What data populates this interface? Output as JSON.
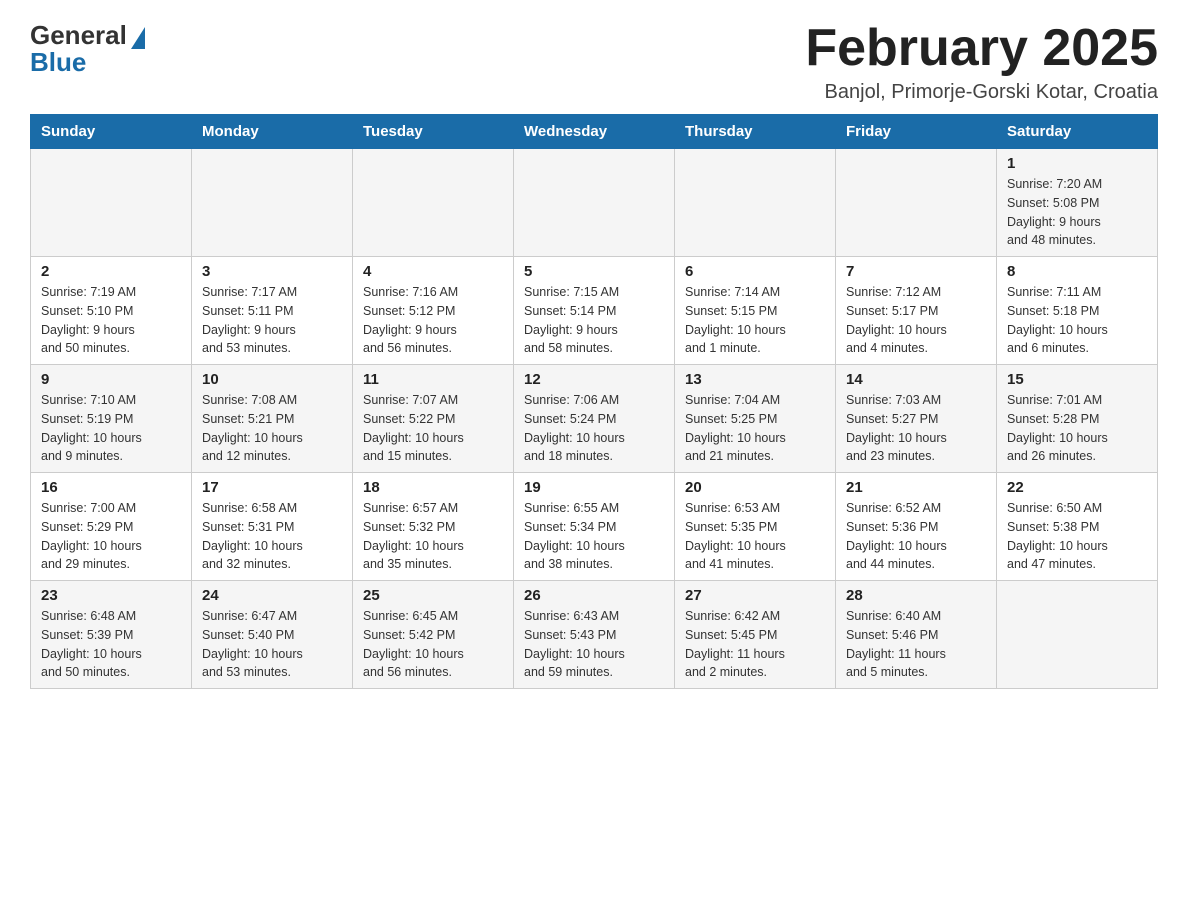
{
  "header": {
    "logo_general": "General",
    "logo_blue": "Blue",
    "title": "February 2025",
    "location": "Banjol, Primorje-Gorski Kotar, Croatia"
  },
  "weekdays": [
    "Sunday",
    "Monday",
    "Tuesday",
    "Wednesday",
    "Thursday",
    "Friday",
    "Saturday"
  ],
  "weeks": [
    [
      {
        "day": "",
        "info": ""
      },
      {
        "day": "",
        "info": ""
      },
      {
        "day": "",
        "info": ""
      },
      {
        "day": "",
        "info": ""
      },
      {
        "day": "",
        "info": ""
      },
      {
        "day": "",
        "info": ""
      },
      {
        "day": "1",
        "info": "Sunrise: 7:20 AM\nSunset: 5:08 PM\nDaylight: 9 hours\nand 48 minutes."
      }
    ],
    [
      {
        "day": "2",
        "info": "Sunrise: 7:19 AM\nSunset: 5:10 PM\nDaylight: 9 hours\nand 50 minutes."
      },
      {
        "day": "3",
        "info": "Sunrise: 7:17 AM\nSunset: 5:11 PM\nDaylight: 9 hours\nand 53 minutes."
      },
      {
        "day": "4",
        "info": "Sunrise: 7:16 AM\nSunset: 5:12 PM\nDaylight: 9 hours\nand 56 minutes."
      },
      {
        "day": "5",
        "info": "Sunrise: 7:15 AM\nSunset: 5:14 PM\nDaylight: 9 hours\nand 58 minutes."
      },
      {
        "day": "6",
        "info": "Sunrise: 7:14 AM\nSunset: 5:15 PM\nDaylight: 10 hours\nand 1 minute."
      },
      {
        "day": "7",
        "info": "Sunrise: 7:12 AM\nSunset: 5:17 PM\nDaylight: 10 hours\nand 4 minutes."
      },
      {
        "day": "8",
        "info": "Sunrise: 7:11 AM\nSunset: 5:18 PM\nDaylight: 10 hours\nand 6 minutes."
      }
    ],
    [
      {
        "day": "9",
        "info": "Sunrise: 7:10 AM\nSunset: 5:19 PM\nDaylight: 10 hours\nand 9 minutes."
      },
      {
        "day": "10",
        "info": "Sunrise: 7:08 AM\nSunset: 5:21 PM\nDaylight: 10 hours\nand 12 minutes."
      },
      {
        "day": "11",
        "info": "Sunrise: 7:07 AM\nSunset: 5:22 PM\nDaylight: 10 hours\nand 15 minutes."
      },
      {
        "day": "12",
        "info": "Sunrise: 7:06 AM\nSunset: 5:24 PM\nDaylight: 10 hours\nand 18 minutes."
      },
      {
        "day": "13",
        "info": "Sunrise: 7:04 AM\nSunset: 5:25 PM\nDaylight: 10 hours\nand 21 minutes."
      },
      {
        "day": "14",
        "info": "Sunrise: 7:03 AM\nSunset: 5:27 PM\nDaylight: 10 hours\nand 23 minutes."
      },
      {
        "day": "15",
        "info": "Sunrise: 7:01 AM\nSunset: 5:28 PM\nDaylight: 10 hours\nand 26 minutes."
      }
    ],
    [
      {
        "day": "16",
        "info": "Sunrise: 7:00 AM\nSunset: 5:29 PM\nDaylight: 10 hours\nand 29 minutes."
      },
      {
        "day": "17",
        "info": "Sunrise: 6:58 AM\nSunset: 5:31 PM\nDaylight: 10 hours\nand 32 minutes."
      },
      {
        "day": "18",
        "info": "Sunrise: 6:57 AM\nSunset: 5:32 PM\nDaylight: 10 hours\nand 35 minutes."
      },
      {
        "day": "19",
        "info": "Sunrise: 6:55 AM\nSunset: 5:34 PM\nDaylight: 10 hours\nand 38 minutes."
      },
      {
        "day": "20",
        "info": "Sunrise: 6:53 AM\nSunset: 5:35 PM\nDaylight: 10 hours\nand 41 minutes."
      },
      {
        "day": "21",
        "info": "Sunrise: 6:52 AM\nSunset: 5:36 PM\nDaylight: 10 hours\nand 44 minutes."
      },
      {
        "day": "22",
        "info": "Sunrise: 6:50 AM\nSunset: 5:38 PM\nDaylight: 10 hours\nand 47 minutes."
      }
    ],
    [
      {
        "day": "23",
        "info": "Sunrise: 6:48 AM\nSunset: 5:39 PM\nDaylight: 10 hours\nand 50 minutes."
      },
      {
        "day": "24",
        "info": "Sunrise: 6:47 AM\nSunset: 5:40 PM\nDaylight: 10 hours\nand 53 minutes."
      },
      {
        "day": "25",
        "info": "Sunrise: 6:45 AM\nSunset: 5:42 PM\nDaylight: 10 hours\nand 56 minutes."
      },
      {
        "day": "26",
        "info": "Sunrise: 6:43 AM\nSunset: 5:43 PM\nDaylight: 10 hours\nand 59 minutes."
      },
      {
        "day": "27",
        "info": "Sunrise: 6:42 AM\nSunset: 5:45 PM\nDaylight: 11 hours\nand 2 minutes."
      },
      {
        "day": "28",
        "info": "Sunrise: 6:40 AM\nSunset: 5:46 PM\nDaylight: 11 hours\nand 5 minutes."
      },
      {
        "day": "",
        "info": ""
      }
    ]
  ]
}
